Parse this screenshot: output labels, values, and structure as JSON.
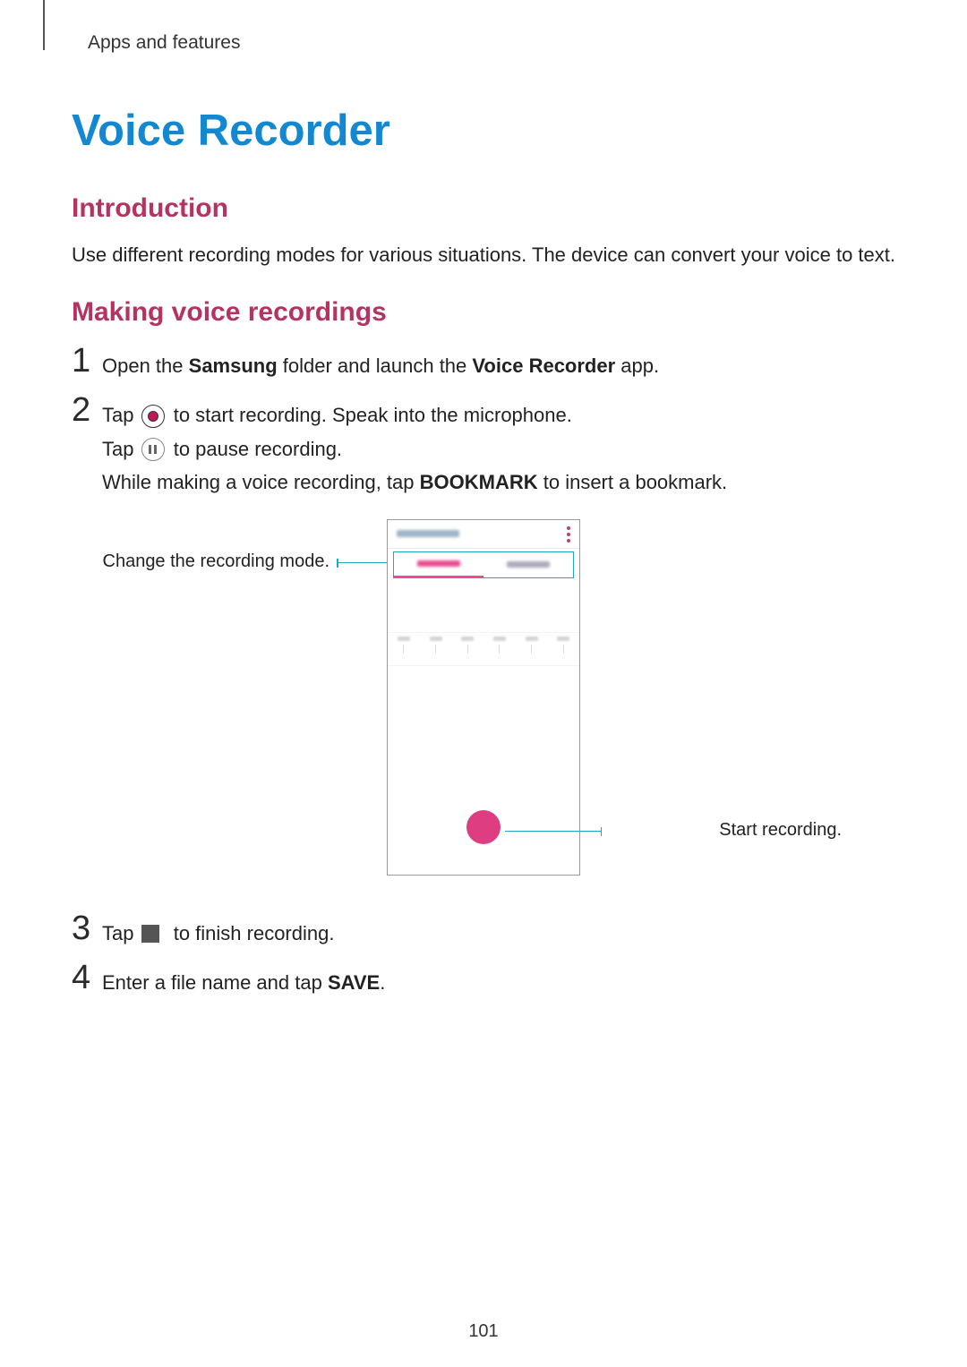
{
  "header": {
    "breadcrumb": "Apps and features"
  },
  "title": "Voice Recorder",
  "intro": {
    "heading": "Introduction",
    "text": "Use different recording modes for various situations. The device can convert your voice to text."
  },
  "making": {
    "heading": "Making voice recordings",
    "steps": [
      {
        "num": "1",
        "lines": [
          {
            "pre": "Open the ",
            "bold1": "Samsung",
            "mid": " folder and launch the ",
            "bold2": "Voice Recorder",
            "post": " app."
          }
        ]
      },
      {
        "num": "2",
        "lines": [
          {
            "pre": "Tap ",
            "icon": "record",
            "post": " to start recording. Speak into the microphone."
          },
          {
            "pre": "Tap ",
            "icon": "pause",
            "post": " to pause recording."
          },
          {
            "pre": "While making a voice recording, tap ",
            "bold1": "BOOKMARK",
            "post": " to insert a bookmark."
          }
        ]
      },
      {
        "num": "3",
        "lines": [
          {
            "pre": "Tap ",
            "icon": "stop",
            "post": " to finish recording."
          }
        ]
      },
      {
        "num": "4",
        "lines": [
          {
            "pre": "Enter a file name and tap ",
            "bold1": "SAVE",
            "post": "."
          }
        ]
      }
    ]
  },
  "callouts": {
    "change_mode": "Change the recording mode.",
    "start_recording": "Start recording."
  },
  "page_number": "101"
}
